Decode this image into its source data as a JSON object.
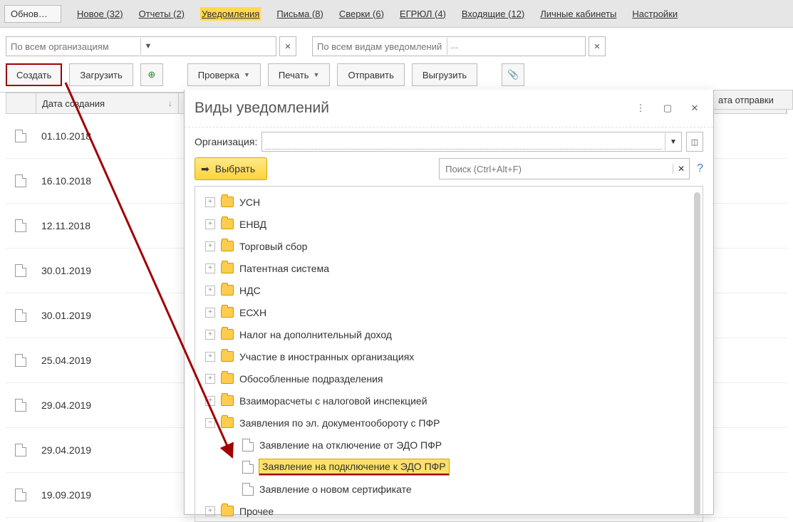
{
  "tabs": {
    "refresh": "Обнов…",
    "items": [
      "Новое (32)",
      "Отчеты (2)",
      "Уведомления",
      "Письма (8)",
      "Сверки (6)",
      "ЕГРЮЛ (4)",
      "Входящие (12)",
      "Личные кабинеты",
      "Настройки"
    ],
    "active_index": 2
  },
  "filters": {
    "org_placeholder": "По всем организациям",
    "type_placeholder": "По всем видам уведомлений"
  },
  "toolbar": {
    "create": "Создать",
    "load": "Загрузить",
    "check": "Проверка",
    "print": "Печать",
    "send": "Отправить",
    "export": "Выгрузить"
  },
  "table": {
    "col_date": "Дата создания",
    "col_sent": "ата отправки",
    "rows": [
      "01.10.2018",
      "16.10.2018",
      "12.11.2018",
      "30.01.2019",
      "30.01.2019",
      "25.04.2019",
      "29.04.2019",
      "29.04.2019",
      "19.09.2019"
    ]
  },
  "modal": {
    "title": "Виды уведомлений",
    "org_label": "Организация:",
    "select": "Выбрать",
    "search_placeholder": "Поиск (Ctrl+Alt+F)",
    "tree": {
      "folders": [
        "УСН",
        "ЕНВД",
        "Торговый сбор",
        "Патентная система",
        "НДС",
        "ЕСХН",
        "Налог на дополнительный доход",
        "Участие в иностранных организациях",
        "Обособленные подразделения",
        "Взаиморасчеты с налоговой инспекцией",
        "Заявления по эл. документообороту с ПФР"
      ],
      "expanded_children": [
        "Заявление на отключение от ЭДО ПФР",
        "Заявление на подключение к ЭДО ПФР",
        "Заявление о новом сертификате"
      ],
      "highlight_index": 1,
      "trailing_folder": "Прочее"
    }
  }
}
